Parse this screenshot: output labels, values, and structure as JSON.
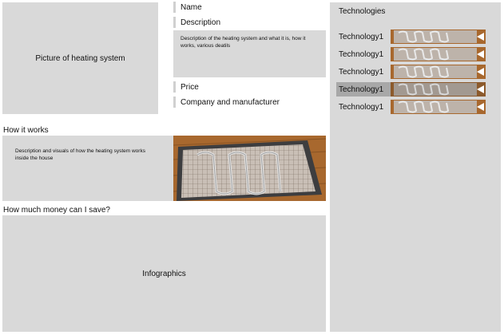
{
  "picture": {
    "label": "Picture of heating system"
  },
  "fields": {
    "name": "Name",
    "description": "Description",
    "description_text": "Description of the heating system and what it is, how it works, various deatils",
    "price": "Price",
    "company": "Company and manufacturer"
  },
  "how_it_works": {
    "title": "How it works",
    "text": "Description and visuals of how the heating system works inside the house"
  },
  "savings": {
    "title": "How much money can I save?",
    "label": "Infographics"
  },
  "technologies": {
    "title": "Technologies",
    "selected_index": 3,
    "items": [
      {
        "label": "Technology1"
      },
      {
        "label": "Technology1"
      },
      {
        "label": "Technology1"
      },
      {
        "label": "Technology1"
      },
      {
        "label": "Technology1"
      }
    ]
  },
  "colors": {
    "panel_gray": "#d9d9d9",
    "selected_gray": "#a8a8a8",
    "wood": "#a8682e"
  },
  "icons": {
    "tech_arrow": "triangle-left-icon"
  }
}
